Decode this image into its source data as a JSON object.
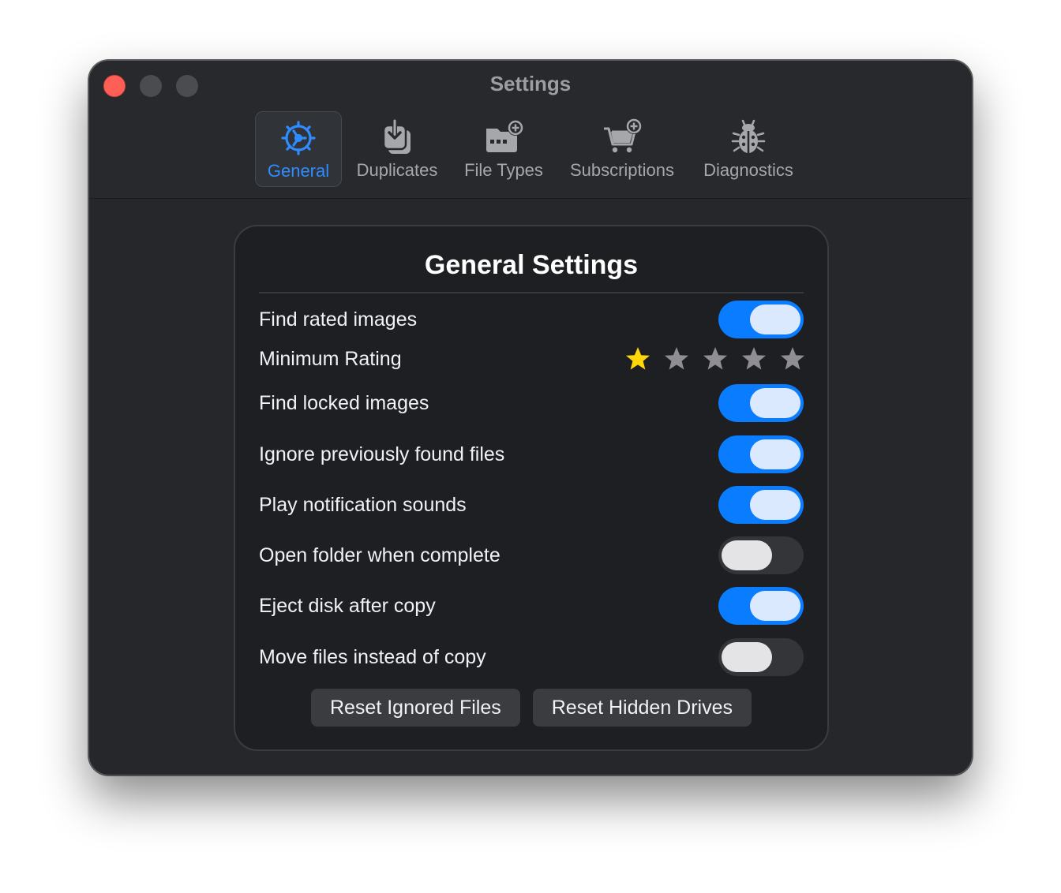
{
  "window": {
    "title": "Settings"
  },
  "colors": {
    "accent": "#0a7cff",
    "selected_tab_text": "#2f8cff",
    "star_active": "#ffd60a",
    "star_inactive": "#8e8e93",
    "close": "#fe5f57"
  },
  "tabs": [
    {
      "label": "General",
      "icon": "gear-icon",
      "selected": true
    },
    {
      "label": "Duplicates",
      "icon": "duplicates-icon",
      "selected": false
    },
    {
      "label": "File Types",
      "icon": "folder-add-icon",
      "selected": false
    },
    {
      "label": "Subscriptions",
      "icon": "cart-add-icon",
      "selected": false
    },
    {
      "label": "Diagnostics",
      "icon": "bug-icon",
      "selected": false
    }
  ],
  "panel": {
    "title": "General Settings",
    "settings": [
      {
        "label": "Find rated images",
        "on": true
      },
      {
        "label": "Minimum Rating",
        "rating": 1,
        "max": 5
      },
      {
        "label": "Find locked images",
        "on": true
      },
      {
        "label": "Ignore previously found files",
        "on": true
      },
      {
        "label": "Play notification sounds",
        "on": true
      },
      {
        "label": "Open folder when complete",
        "on": false
      },
      {
        "label": "Eject disk after copy",
        "on": true
      },
      {
        "label": "Move files instead of copy",
        "on": false
      }
    ],
    "buttons": {
      "reset_ignored": "Reset Ignored Files",
      "reset_hidden": "Reset Hidden Drives"
    }
  }
}
